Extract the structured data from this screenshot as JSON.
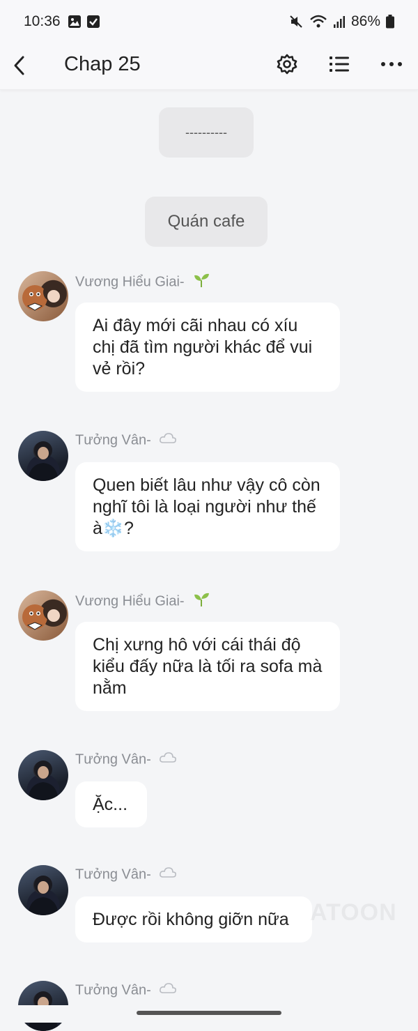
{
  "status_bar": {
    "time": "10:36",
    "battery": "86%",
    "icons": [
      "gallery-icon",
      "checkbox-icon",
      "mute-icon",
      "wifi-icon",
      "signal-icon",
      "battery-icon"
    ]
  },
  "app_bar": {
    "title": "Chap 25",
    "icons": [
      "back-icon",
      "gear-icon",
      "list-icon",
      "more-icon"
    ]
  },
  "divider": {
    "text": "----------"
  },
  "scene": {
    "text": "Quán cafe"
  },
  "messages": [
    {
      "name": "Vương Hiểu Giai-",
      "badge": "sprout-icon",
      "avatar": "girl",
      "text": "Ai đây mới cãi nhau có xíu chị đã tìm người khác để vui vẻ rồi?"
    },
    {
      "name": "Tưởng Vân-",
      "badge": "cloud-icon",
      "avatar": "boy",
      "text": "Quen biết lâu như vậy cô còn nghĩ tôi là loại người như thế à❄️?"
    },
    {
      "name": "Vương Hiểu Giai-",
      "badge": "sprout-icon",
      "avatar": "girl",
      "text": "Chị xưng hô với cái thái độ kiểu đấy nữa là tối ra sofa mà nằm"
    },
    {
      "name": "Tưởng Vân-",
      "badge": "cloud-icon",
      "avatar": "boy",
      "text": "Ặc..."
    },
    {
      "name": "Tưởng Vân-",
      "badge": "cloud-icon",
      "avatar": "boy",
      "text": "Được rồi không giỡn nữa"
    },
    {
      "name": "Tưởng Vân-",
      "badge": "cloud-icon",
      "avatar": "boy",
      "text": ""
    }
  ],
  "watermark": "ATOON",
  "colors": {
    "background": "#f4f5f7",
    "bubble": "#ffffff",
    "pill": "#e8e8ea",
    "name": "#8a8d93"
  }
}
